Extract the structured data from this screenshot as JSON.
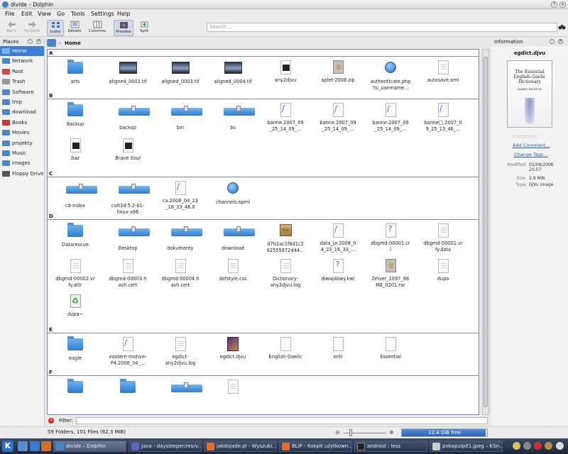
{
  "window": {
    "title": "divide – Dolphin"
  },
  "menu": [
    "File",
    "Edit",
    "View",
    "Go",
    "Tools",
    "Settings",
    "Help"
  ],
  "toolbar": {
    "back": "Back",
    "forward": "Forward",
    "icons": "Icons",
    "details": "Details",
    "columns": "Columns",
    "preview": "Preview",
    "split": "Split"
  },
  "search": {
    "placeholder": "Search..."
  },
  "places": {
    "header": "Places",
    "items": [
      "Home",
      "Network",
      "Root",
      "Trash",
      "Software",
      "tmp",
      "download",
      "Books",
      "Movies",
      "projekty",
      "Music",
      "Images",
      "Floppy Drive"
    ]
  },
  "breadcrumb": {
    "current": "Home"
  },
  "groups": [
    {
      "label": "A",
      "items": [
        {
          "name": "arts",
          "type": "folder"
        },
        {
          "name": "aligned_0002.tif",
          "type": "image"
        },
        {
          "name": "aligned_0003.tif",
          "type": "image"
        },
        {
          "name": "aligned_0004.tif",
          "type": "image"
        },
        {
          "name": "any2djvu",
          "type": "terminal"
        },
        {
          "name": "aplet-2008.zip",
          "type": "zip"
        },
        {
          "name": "authenticate.php\n?si_username...",
          "type": "globe"
        },
        {
          "name": "autosave.xmi",
          "type": "doc"
        }
      ]
    },
    {
      "label": "B",
      "items": [
        {
          "name": "Backup",
          "type": "folder"
        },
        {
          "name": "backup",
          "type": "wide"
        },
        {
          "name": "bin",
          "type": "wide"
        },
        {
          "name": "bs",
          "type": "wide"
        },
        {
          "name": "banne.2007_09\n_25_14_09_...",
          "type": "vector"
        },
        {
          "name": "banne.2007_09\n_25_14_09_...",
          "type": "vector"
        },
        {
          "name": "banne.2007_09\n_25_14_09_...",
          "type": "vector"
        },
        {
          "name": "banne□.2007_0\n9_25_13_46_...",
          "type": "vector"
        },
        {
          "name": "baz",
          "type": "terminal",
          "italic": true
        },
        {
          "name": "Brave Soul",
          "type": "terminal",
          "italic": true
        }
      ]
    },
    {
      "label": "C",
      "items": [
        {
          "name": "cd-index",
          "type": "wide"
        },
        {
          "name": "cult3d-5.2-b1-\nlinux-x86",
          "type": "wide"
        },
        {
          "name": "ca.2008_04_23\n_16_33_46.0",
          "type": "vector"
        },
        {
          "name": "channels.opml",
          "type": "globe"
        }
      ]
    },
    {
      "label": "D",
      "items": [
        {
          "name": "Datarescue",
          "type": "folder"
        },
        {
          "name": "Desktop",
          "type": "wide"
        },
        {
          "name": "dokumenty",
          "type": "wide"
        },
        {
          "name": "download",
          "type": "wide"
        },
        {
          "name": "d7b2ac1f6d1c2\n82555872d44...",
          "type": "tgz"
        },
        {
          "name": "data_ur.2008_0\n4_23_16_33_...",
          "type": "vector"
        },
        {
          "name": "dbgmd-00001.cr\nl",
          "type": "question"
        },
        {
          "name": "dbgmd-00001.vr\nfy.data",
          "type": "doc"
        },
        {
          "name": "dbgmd-00002.vr\nfy.attr",
          "type": "doc"
        },
        {
          "name": "dbgmd-00003.h\nash.cert",
          "type": "doc"
        },
        {
          "name": "dbgmd-00004.h\nash.cert",
          "type": "doc"
        },
        {
          "name": "defstyle.css",
          "type": "doc"
        },
        {
          "name": "Dictionary-\nany2djvu.log",
          "type": "doc"
        },
        {
          "name": "diwajdowy.kwl",
          "type": "question"
        },
        {
          "name": "Driver_1097_98\nME_0201.rar",
          "type": "zip"
        },
        {
          "name": "dupa",
          "type": "doc"
        },
        {
          "name": "dupa~",
          "type": "recycle"
        }
      ]
    },
    {
      "label": "E",
      "items": [
        {
          "name": "eagle",
          "type": "folder"
        },
        {
          "name": "eastern-motive-\nP4.2008_04_...",
          "type": "vector"
        },
        {
          "name": "egdict-\nany2djvu.log",
          "type": "doc"
        },
        {
          "name": "egdict.djvu",
          "type": "djvu"
        },
        {
          "name": "English-Gaelic",
          "type": "blank"
        },
        {
          "name": "enh",
          "type": "blank"
        },
        {
          "name": "Essential",
          "type": "blank"
        }
      ]
    },
    {
      "label": "F",
      "items": [
        {
          "name": "",
          "type": "folder"
        },
        {
          "name": "",
          "type": "folder"
        },
        {
          "name": "",
          "type": "wide"
        },
        {
          "name": "",
          "type": "doc"
        }
      ]
    }
  ],
  "info": {
    "header": "Information",
    "filename": "egdict.djvu",
    "cover_title": "The Essential English–Gaelic Dictionary",
    "cover_author": "JAMES WATSON",
    "add_comment": "Add Comment...",
    "change_tags": "Change Tags...",
    "modified_label": "Modified:",
    "modified_value": "02/08/2006 20:57",
    "size_label": "Size:",
    "size_value": "2,9 MiB",
    "type_label": "Type:",
    "type_value": "DjVu image"
  },
  "filter": {
    "label": "Filter:"
  },
  "status": {
    "text": "59 Folders, 101 Files (62,3 MiB)",
    "free": "12,4 GiB free",
    "free_fraction": 0.98
  },
  "taskbar": {
    "tasks": [
      "divide – Dolphin",
      "Java - daysleeper/res/v...",
      "jakdojade.pl - Wyszuki...",
      "BLIP - Kokpit użytkown...",
      "android : less",
      "pokapulpit1.jpeg – KSn..."
    ]
  },
  "colors": {
    "accent": "#3d7ed0",
    "folder": "#2d7cd2",
    "taskbar": "#1d2638"
  }
}
